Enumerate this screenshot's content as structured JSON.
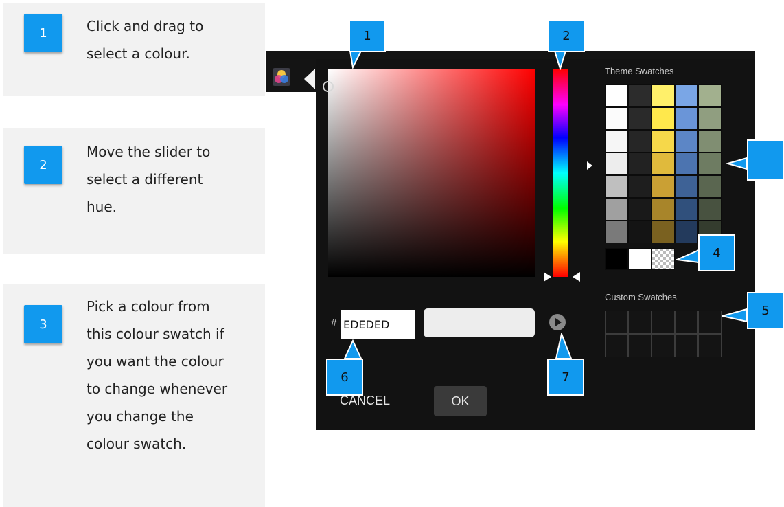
{
  "steps": [
    {
      "number": "1",
      "lines": [
        "Click and drag to",
        "select a colour."
      ]
    },
    {
      "number": "2",
      "lines": [
        "Move the slider to",
        "select a different",
        "hue."
      ]
    },
    {
      "number": "3",
      "lines": [
        "Pick a colour from",
        "this colour swatch if",
        "you want the colour",
        "to change whenever",
        "you change the",
        "colour swatch."
      ]
    }
  ],
  "picker": {
    "theme_swatches_label": "Theme Swatches",
    "custom_swatches_label": "Custom Swatches",
    "hash": "#",
    "hex_value": "EDEDED",
    "cancel_label": "CANCEL",
    "ok_label": "OK"
  },
  "theme_swatch_colors": [
    [
      "#ffffff",
      "#2c2c2c",
      "#fff06a",
      "#7aa6e6",
      "#a2b08e"
    ],
    [
      "#fbfbfb",
      "#2a2a2a",
      "#ffe84c",
      "#6a95d8",
      "#909e80"
    ],
    [
      "#f6f6f6",
      "#262626",
      "#f6d84a",
      "#5c86c6",
      "#808e72"
    ],
    [
      "#ededed",
      "#222222",
      "#e0ba3c",
      "#4c74b0",
      "#6e7c62"
    ],
    [
      "#bfbfbf",
      "#1e1e1e",
      "#caa034",
      "#3e6296",
      "#5a6650"
    ],
    [
      "#a0a0a0",
      "#191919",
      "#a8852a",
      "#30507c",
      "#485240"
    ],
    [
      "#7a7a7a",
      "#141414",
      "#7a6120",
      "#233a5c",
      "#343c2e"
    ]
  ],
  "bottom_swatches": [
    "#000000",
    "#ffffff",
    "transparent"
  ],
  "callouts": [
    "1",
    "2",
    "4",
    "5",
    "6",
    "7"
  ]
}
